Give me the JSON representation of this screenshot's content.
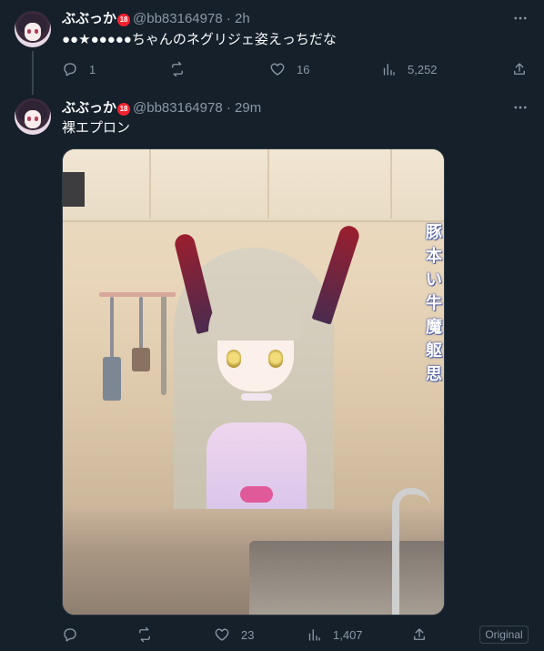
{
  "tweets": [
    {
      "name": "ぶぶっか",
      "badge": "18",
      "handle": "@bb83164978",
      "separator": "·",
      "time": "2h",
      "text": "●●★●●●●●ちゃんのネグリジェ姿えっちだな",
      "actions": {
        "reply": "1",
        "retweet": "",
        "like": "16",
        "views": "5,252"
      }
    },
    {
      "name": "ぶぶっか",
      "badge": "18",
      "handle": "@bb83164978",
      "separator": "·",
      "time": "29m",
      "text": "裸エプロン",
      "media_vertical_text": [
        "豚",
        "本",
        "い",
        "牛",
        "魔",
        "躯",
        "思"
      ],
      "actions": {
        "reply": "",
        "retweet": "",
        "like": "23",
        "views": "1,407"
      },
      "original_label": "Original"
    }
  ],
  "icons": {
    "reply": "reply-icon",
    "retweet": "retweet-icon",
    "like": "heart-icon",
    "views": "views-icon",
    "share": "share-icon",
    "more": "more-icon"
  },
  "colors": {
    "background": "#15202b",
    "muted": "#8b98a5",
    "text": "#f7f9f9",
    "badge": "#f4212e"
  }
}
